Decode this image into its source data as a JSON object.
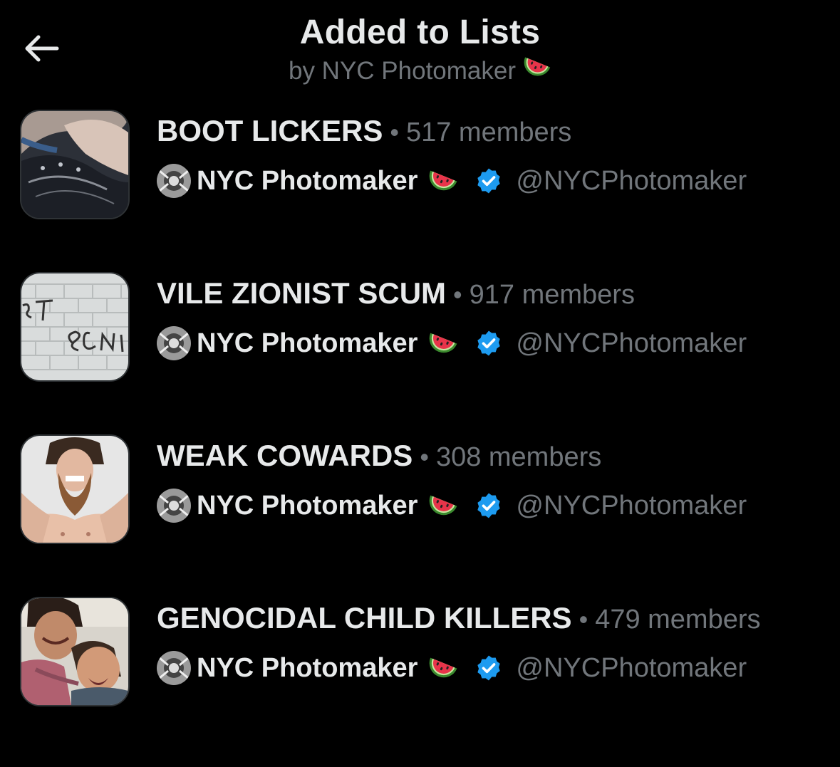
{
  "header": {
    "title": "Added to Lists",
    "subtitle": "by NYC Photomaker",
    "back_icon": "arrow-left-icon",
    "subtitle_emoji": "watermelon-icon"
  },
  "lists": [
    {
      "name": "BOOT LICKERS",
      "members": "517 members",
      "owner_name": "NYC Photomaker",
      "owner_handle": "@NYCPhotomaker",
      "thumb": "boot-photo"
    },
    {
      "name": "VILE ZIONIST SCUM",
      "members": "917 members",
      "owner_name": "NYC Photomaker",
      "owner_handle": "@NYCPhotomaker",
      "thumb": "graffiti-wall-photo"
    },
    {
      "name": "WEAK COWARDS",
      "members": "308 members",
      "owner_name": "NYC Photomaker",
      "owner_handle": "@NYCPhotomaker",
      "thumb": "bearded-man-photo"
    },
    {
      "name": "GENOCIDAL CHILD KILLERS",
      "members": "479 members",
      "owner_name": "NYC Photomaker",
      "owner_handle": "@NYCPhotomaker",
      "thumb": "crying-children-photo"
    }
  ],
  "separator": "•",
  "colors": {
    "background": "#000000",
    "text_primary": "#e7e9ea",
    "text_secondary": "#71767b",
    "verified_blue": "#1d9bf0"
  }
}
